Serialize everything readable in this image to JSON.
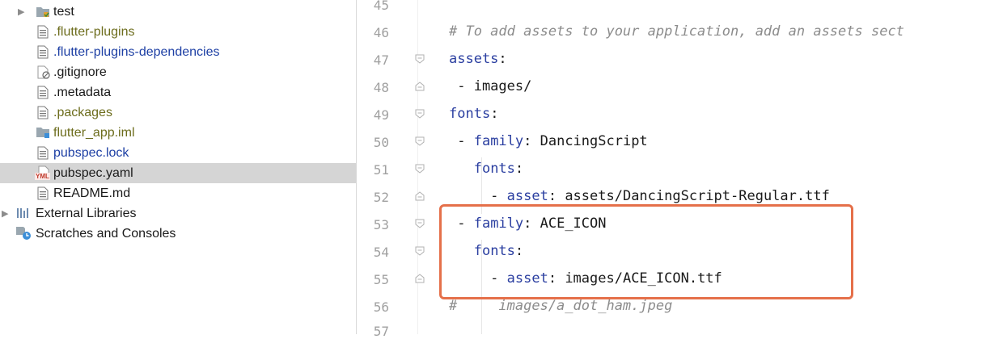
{
  "tree": {
    "items": [
      {
        "label": "test",
        "icon": "folder-test-icon",
        "color": "black"
      },
      {
        "label": ".flutter-plugins",
        "icon": "text-file-icon",
        "color": "olive"
      },
      {
        "label": ".flutter-plugins-dependencies",
        "icon": "text-file-icon",
        "color": "blue"
      },
      {
        "label": ".gitignore",
        "icon": "ignore-file-icon",
        "color": "black"
      },
      {
        "label": ".metadata",
        "icon": "text-file-icon",
        "color": "black"
      },
      {
        "label": ".packages",
        "icon": "text-file-icon",
        "color": "olive"
      },
      {
        "label": "flutter_app.iml",
        "icon": "module-file-icon",
        "color": "olive"
      },
      {
        "label": "pubspec.lock",
        "icon": "text-file-icon",
        "color": "blue"
      },
      {
        "label": "pubspec.yaml",
        "icon": "yaml-file-icon",
        "color": "black",
        "selected": true
      },
      {
        "label": "README.md",
        "icon": "text-file-icon",
        "color": "black"
      },
      {
        "label": "External Libraries",
        "icon": "libraries-icon",
        "color": "black"
      },
      {
        "label": "Scratches and Consoles",
        "icon": "scratches-icon",
        "color": "black"
      }
    ],
    "yaml_badge": "YML"
  },
  "editor": {
    "line_numbers": [
      "45",
      "46",
      "47",
      "48",
      "49",
      "50",
      "51",
      "52",
      "53",
      "54",
      "55",
      "56",
      "57"
    ],
    "lines": {
      "l46": "# To add assets to your application, add an assets sect",
      "l47_key": "assets",
      "l47_rest": ":",
      "l48": " - images/",
      "l49_key": "fonts",
      "l49_rest": ":",
      "l50_pre": " - ",
      "l50_key": "family",
      "l50_rest": ": DancingScript",
      "l51_pre": "   ",
      "l51_key": "fonts",
      "l51_rest": ":",
      "l52_pre": "     - ",
      "l52_key": "asset",
      "l52_rest": ": assets/DancingScript-Regular.ttf",
      "l53_pre": " - ",
      "l53_key": "family",
      "l53_rest": ": ACE_ICON",
      "l54_pre": "   ",
      "l54_key": "fonts",
      "l54_rest": ":",
      "l55_pre": "     - ",
      "l55_key": "asset",
      "l55_rest": ": images/ACE_ICON.ttf",
      "l56": "#     images/a_dot_ham.jpeg"
    },
    "highlight_color": "#e5704a"
  }
}
